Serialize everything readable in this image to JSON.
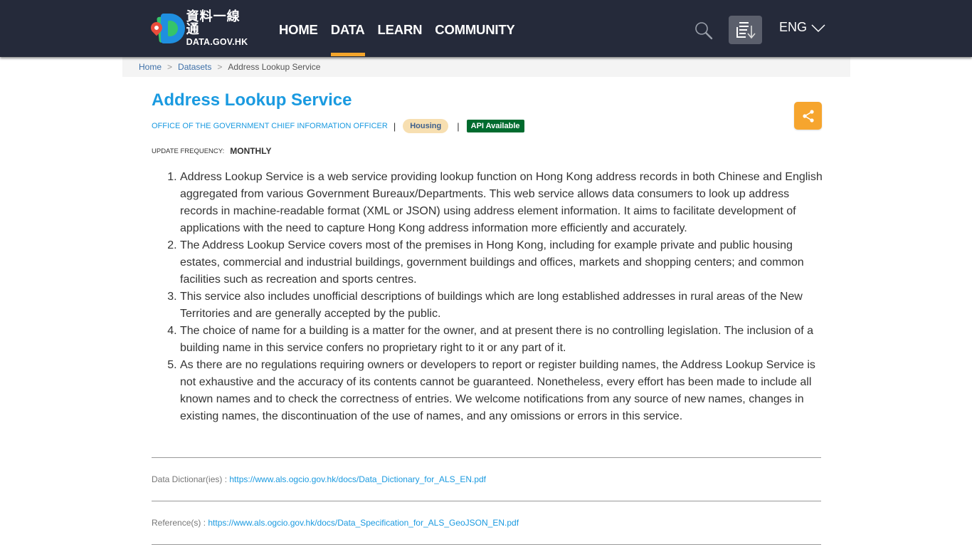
{
  "header": {
    "logo": {
      "zh": "資料一線通",
      "en": "DATA.GOV.HK"
    },
    "nav": [
      {
        "label": "HOME",
        "active": false
      },
      {
        "label": "DATA",
        "active": true
      },
      {
        "label": "LEARN",
        "active": false
      },
      {
        "label": "COMMUNITY",
        "active": false
      }
    ],
    "search_icon": "search-icon",
    "download_icon": "download-list-icon",
    "language": "ENG",
    "accent_color": "#f4a52b",
    "background_color": "#252a3a"
  },
  "breadcrumb": {
    "items": [
      "Home",
      "Datasets"
    ],
    "current": "Address Lookup Service",
    "separator": ">"
  },
  "dataset": {
    "title": "Address Lookup Service",
    "organization": "OFFICE OF THE GOVERNMENT CHIEF INFORMATION OFFICER",
    "category": "Housing",
    "api_badge": "API Available",
    "update_frequency_label": "UPDATE FREQUENCY:",
    "update_frequency": "MONTHLY",
    "share_icon": "share-icon",
    "description": [
      "Address Lookup Service is a web service providing lookup function on Hong Kong address records in both Chinese and English aggregated from various Government Bureaux/Departments. This web service allows data consumers to look up address records in machine-readable format (XML or JSON) using address element information. It aims to facilitate development of applications with the need to capture Hong Kong address information more efficiently and accurately.",
      "The Address Lookup Service covers most of the premises in Hong Kong, including for example private and public housing estates, commercial and industrial buildings, government buildings and offices, markets and shopping centers; and common facilities such as recreation and sports centres.",
      "This service also includes unofficial descriptions of buildings which are long established addresses in rural areas of the New Territories and are generally accepted by the public.",
      "The choice of name for a building is a matter for the owner, and at present there is no controlling legislation. The inclusion of a building name in this service confers no proprietary right to it or any part of it.",
      "As there are no regulations requiring owners or developers to report or register building names, the Address Lookup Service is not exhaustive and the accuracy of its contents cannot be guaranteed. Nonetheless, every effort has been made to include all known names and to check the correctness of entries. We welcome notifications from any source of new names, changes in existing names, the discontinuation of the use of names, and any omissions or errors in this service."
    ],
    "data_dictionary_label": "Data Dictionar(ies) : ",
    "data_dictionary_url": "https://www.als.ogcio.gov.hk/docs/Data_Dictionary_for_ALS_EN.pdf",
    "reference_label": "Reference(s) : ",
    "reference_url": "https://www.als.ogcio.gov.hk/docs/Data_Specification_for_ALS_GeoJSON_EN.pdf"
  }
}
